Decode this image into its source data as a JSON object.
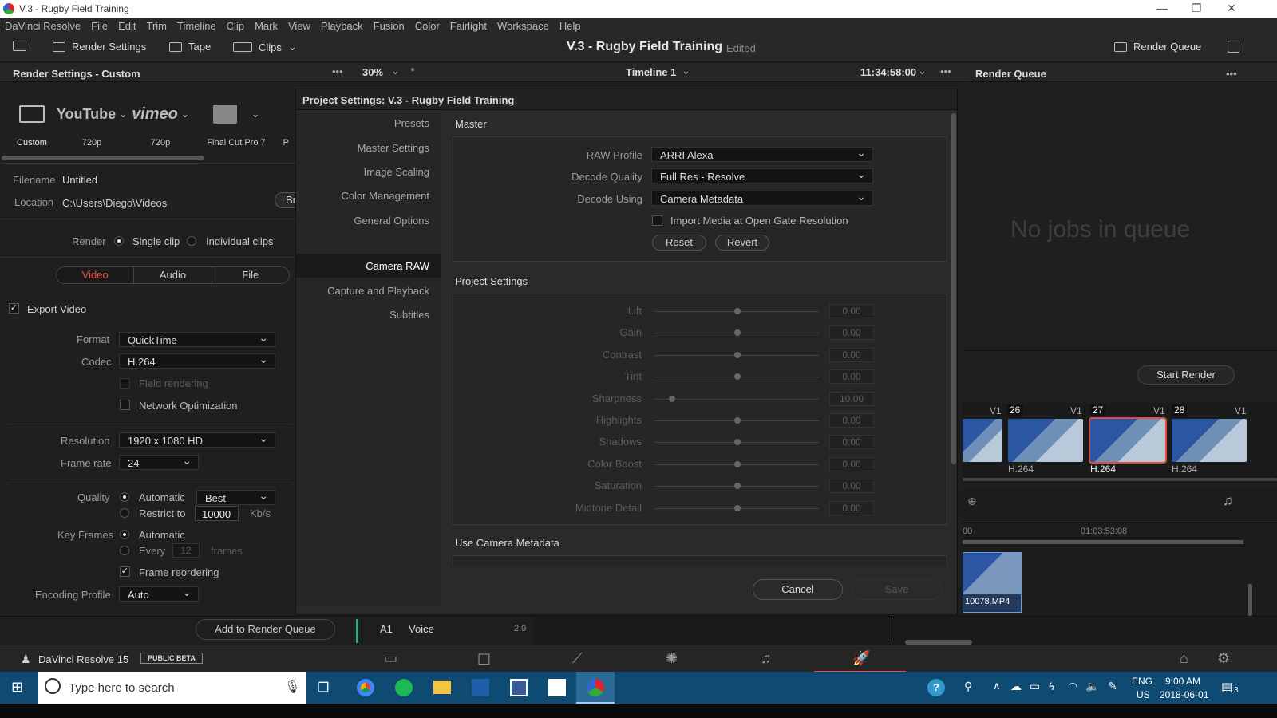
{
  "window": {
    "title": "V.3 - Rugby Field Training"
  },
  "menu": [
    "DaVinci Resolve",
    "File",
    "Edit",
    "Trim",
    "Timeline",
    "Clip",
    "Mark",
    "View",
    "Playback",
    "Fusion",
    "Color",
    "Fairlight",
    "Workspace",
    "Help"
  ],
  "toolbar": {
    "render_settings": "Render Settings",
    "tape": "Tape",
    "clips": "Clips",
    "project_title": "V.3 - Rugby Field Training",
    "edited": "Edited",
    "render_queue": "Render Queue"
  },
  "render_settings": {
    "title": "Render Settings - Custom",
    "presets": [
      {
        "name": "Custom",
        "icon": "film-icon"
      },
      {
        "name": "720p",
        "icon": "youtube-logo",
        "brand": "YouTube"
      },
      {
        "name": "720p",
        "icon": "vimeo-logo",
        "brand": "vimeo"
      },
      {
        "name": "Final Cut Pro 7",
        "icon": "clapper-icon"
      },
      {
        "name": "P"
      }
    ],
    "filename_label": "Filename",
    "filename": "Untitled",
    "location_label": "Location",
    "location": "C:\\Users\\Diego\\Videos",
    "browse": "Br",
    "render_label": "Render",
    "single_clip": "Single clip",
    "individual_clips": "Individual clips",
    "tabs": [
      "Video",
      "Audio",
      "File"
    ],
    "export_video": "Export Video",
    "format_label": "Format",
    "format": "QuickTime",
    "codec_label": "Codec",
    "codec": "H.264",
    "field_rendering": "Field rendering",
    "network_optimization": "Network Optimization",
    "resolution_label": "Resolution",
    "resolution": "1920 x 1080 HD",
    "framerate_label": "Frame rate",
    "framerate": "24",
    "quality_label": "Quality",
    "automatic": "Automatic",
    "quality": "Best",
    "restrict_to": "Restrict to",
    "restrict_value": "10000",
    "kbs": "Kb/s",
    "keyframes_label": "Key Frames",
    "kf_automatic": "Automatic",
    "every": "Every",
    "every_value": "12",
    "frames": "frames",
    "frame_reordering": "Frame reordering",
    "encoding_label": "Encoding Profile",
    "encoding": "Auto",
    "add_to_queue": "Add to Render Queue"
  },
  "viewer": {
    "zoom": "30%",
    "timeline": "Timeline 1",
    "timecode": "11:34:58:00"
  },
  "dialog": {
    "title": "Project Settings:  V.3 - Rugby Field Training",
    "nav": [
      "Presets",
      "Master Settings",
      "Image Scaling",
      "Color Management",
      "General Options",
      "Camera RAW",
      "Capture and Playback",
      "Subtitles"
    ],
    "section_master": "Master",
    "raw_profile_label": "RAW Profile",
    "raw_profile": "ARRI Alexa",
    "decode_quality_label": "Decode Quality",
    "decode_quality": "Full Res - Resolve",
    "decode_using_label": "Decode Using",
    "decode_using": "Camera Metadata",
    "import_open_gate": "Import Media at Open Gate Resolution",
    "reset": "Reset",
    "revert": "Revert",
    "section_project": "Project Settings",
    "sliders": [
      {
        "name": "Lift",
        "value": "0.00",
        "pos": 0.5
      },
      {
        "name": "Gain",
        "value": "0.00",
        "pos": 0.5
      },
      {
        "name": "Contrast",
        "value": "0.00",
        "pos": 0.5
      },
      {
        "name": "Tint",
        "value": "0.00",
        "pos": 0.5
      },
      {
        "name": "Sharpness",
        "value": "10.00",
        "pos": 0.1
      },
      {
        "name": "Highlights",
        "value": "0.00",
        "pos": 0.5
      },
      {
        "name": "Shadows",
        "value": "0.00",
        "pos": 0.5
      },
      {
        "name": "Color Boost",
        "value": "0.00",
        "pos": 0.5
      },
      {
        "name": "Saturation",
        "value": "0.00",
        "pos": 0.5
      },
      {
        "name": "Midtone Detail",
        "value": "0.00",
        "pos": 0.5
      }
    ],
    "section_metadata": "Use Camera Metadata",
    "cancel": "Cancel",
    "save": "Save"
  },
  "render_queue": {
    "title": "Render Queue",
    "empty": "No jobs in queue",
    "start_render": "Start Render"
  },
  "clips": [
    {
      "num": "",
      "track": "V1",
      "codec": ""
    },
    {
      "num": "26",
      "track": "V1",
      "codec": "H.264"
    },
    {
      "num": "27",
      "track": "V1",
      "codec": "H.264"
    },
    {
      "num": "28",
      "track": "V1",
      "codec": "H.264"
    }
  ],
  "timeline": {
    "tc_left": "00",
    "tc_right": "01:03:53:08",
    "clip_name": "10078.MP4"
  },
  "audio_track": {
    "name": "A1",
    "label": "Voice",
    "channels": "2.0"
  },
  "pagebar": {
    "app_name": "DaVinci Resolve 15",
    "beta": "PUBLIC BETA"
  },
  "taskbar": {
    "search": "Type here to search",
    "lang": "ENG",
    "region": "US",
    "time": "9:00 AM",
    "date": "2018-06-01",
    "notif": "3"
  }
}
